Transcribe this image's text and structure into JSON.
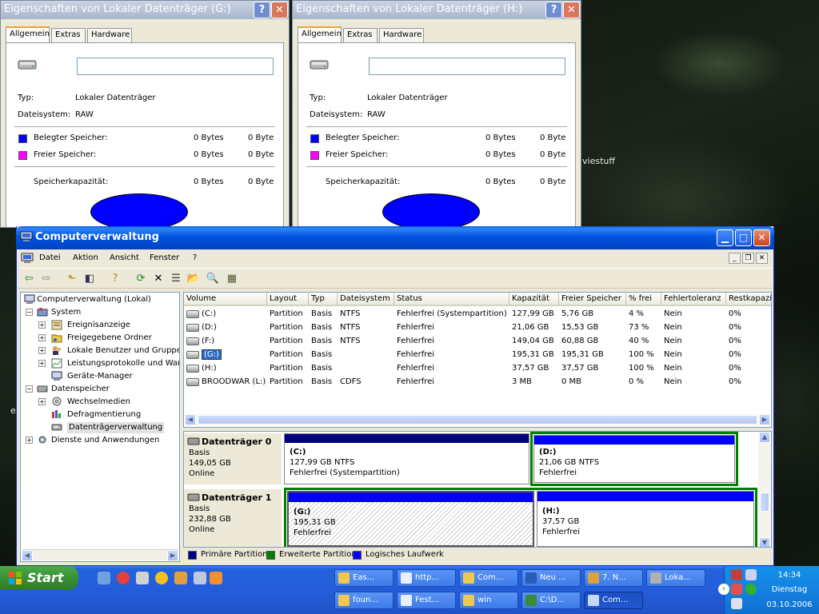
{
  "desktop": {
    "labels": [
      "viestuff",
      "e"
    ]
  },
  "prop_windows": [
    {
      "title": "Eigenschaften von Lokaler Datenträger (G:)",
      "help": "?",
      "close": "✕",
      "tabs": [
        "Allgemein",
        "Extras",
        "Hardware"
      ],
      "type_label": "Typ:",
      "type_value": "Lokaler Datenträger",
      "fs_label": "Dateisystem:",
      "fs_value": "RAW",
      "used_label": "Belegter Speicher:",
      "used_bytes": "0 Bytes",
      "used_short": "0 Byte",
      "free_label": "Freier Speicher:",
      "free_bytes": "0 Bytes",
      "free_short": "0 Byte",
      "cap_label": "Speicherkapazität:",
      "cap_bytes": "0 Bytes",
      "cap_short": "0 Byte"
    },
    {
      "title": "Eigenschaften von Lokaler Datenträger (H:)",
      "help": "?",
      "close": "✕",
      "tabs": [
        "Allgemein",
        "Extras",
        "Hardware"
      ],
      "type_label": "Typ:",
      "type_value": "Lokaler Datenträger",
      "fs_label": "Dateisystem:",
      "fs_value": "RAW",
      "used_label": "Belegter Speicher:",
      "used_bytes": "0 Bytes",
      "used_short": "0 Byte",
      "free_label": "Freier Speicher:",
      "free_bytes": "0 Bytes",
      "free_short": "0 Byte",
      "cap_label": "Speicherkapazität:",
      "cap_bytes": "0 Bytes",
      "cap_short": "0 Byte"
    }
  ],
  "colors": {
    "used": "#0000ff",
    "free": "#ff00ff",
    "primary": "#000080",
    "extended": "#008000",
    "logical": "#0000ff"
  },
  "main": {
    "title": "Computerverwaltung",
    "menu": [
      "Datei",
      "Aktion",
      "Ansicht",
      "Fenster",
      "?"
    ],
    "toolbar_icons": [
      "back-icon",
      "forward-icon",
      "up-folder-icon",
      "show-hide-tree-icon",
      "help-icon",
      "refresh-icon",
      "delete-icon",
      "properties-icon",
      "open-icon",
      "search-icon",
      "settings-icon"
    ],
    "tree": {
      "root": "Computerverwaltung (Lokal)",
      "system": "System",
      "event": "Ereignisanzeige",
      "shared": "Freigegebene Ordner",
      "users": "Lokale Benutzer und Gruppen",
      "perf": "Leistungsprotokolle und Warnungen",
      "devmgr": "Geräte-Manager",
      "storage": "Datenspeicher",
      "removable": "Wechselmedien",
      "defrag": "Defragmentierung",
      "diskmgmt": "Datenträgerverwaltung",
      "services": "Dienste und Anwendungen"
    },
    "columns": [
      "Volume",
      "Layout",
      "Typ",
      "Dateisystem",
      "Status",
      "Kapazität",
      "Freier Speicher",
      "% frei",
      "Fehlertoleranz",
      "Restkapazität"
    ],
    "volumes": [
      {
        "vol": "(C:)",
        "layout": "Partition",
        "typ": "Basis",
        "fs": "NTFS",
        "status": "Fehlerfrei (Systempartition)",
        "cap": "127,99 GB",
        "free": "5,76 GB",
        "pct": "4 %",
        "ft": "Nein",
        "rest": "0%"
      },
      {
        "vol": "(D:)",
        "layout": "Partition",
        "typ": "Basis",
        "fs": "NTFS",
        "status": "Fehlerfrei",
        "cap": "21,06 GB",
        "free": "15,53 GB",
        "pct": "73 %",
        "ft": "Nein",
        "rest": "0%"
      },
      {
        "vol": "(F:)",
        "layout": "Partition",
        "typ": "Basis",
        "fs": "NTFS",
        "status": "Fehlerfrei",
        "cap": "149,04 GB",
        "free": "60,88 GB",
        "pct": "40 %",
        "ft": "Nein",
        "rest": "0%"
      },
      {
        "vol": "(G:)",
        "layout": "Partition",
        "typ": "Basis",
        "fs": "",
        "status": "Fehlerfrei",
        "cap": "195,31 GB",
        "free": "195,31 GB",
        "pct": "100 %",
        "ft": "Nein",
        "rest": "0%"
      },
      {
        "vol": "(H:)",
        "layout": "Partition",
        "typ": "Basis",
        "fs": "",
        "status": "Fehlerfrei",
        "cap": "37,57 GB",
        "free": "37,57 GB",
        "pct": "100 %",
        "ft": "Nein",
        "rest": "0%"
      },
      {
        "vol": "BROODWAR (L:)",
        "layout": "Partition",
        "typ": "Basis",
        "fs": "CDFS",
        "status": "Fehlerfrei",
        "cap": "3 MB",
        "free": "0 MB",
        "pct": "0 %",
        "ft": "Nein",
        "rest": "0%"
      }
    ],
    "disks": [
      {
        "name": "Datenträger 0",
        "kind": "Basis",
        "size": "149,05 GB",
        "state": "Online",
        "parts": [
          {
            "label": "(C:)",
            "detail": "127,99 GB NTFS",
            "status": "Fehlerfrei (Systempartition)"
          },
          {
            "label": "(D:)",
            "detail": "21,06 GB NTFS",
            "status": "Fehlerfrei"
          }
        ]
      },
      {
        "name": "Datenträger 1",
        "kind": "Basis",
        "size": "232,88 GB",
        "state": "Online",
        "parts": [
          {
            "label": "(G:)",
            "detail": "195,31 GB",
            "status": "Fehlerfrei"
          },
          {
            "label": "(H:)",
            "detail": "37,57 GB",
            "status": "Fehlerfrei"
          }
        ]
      }
    ],
    "legend": [
      "Primäre Partition",
      "Erweiterte Partition",
      "Logisches Laufwerk"
    ]
  },
  "taskbar": {
    "start": "Start",
    "tasks_row1": [
      "Eas...",
      "http...",
      "Com...",
      "Neu ...",
      "7. N...",
      "Loka..."
    ],
    "tasks_row2": [
      "foun...",
      "Fest...",
      "win",
      "C:\\D...",
      "Com..."
    ],
    "time": "14:34",
    "day": "Dienstag",
    "date": "03.10.2006"
  }
}
